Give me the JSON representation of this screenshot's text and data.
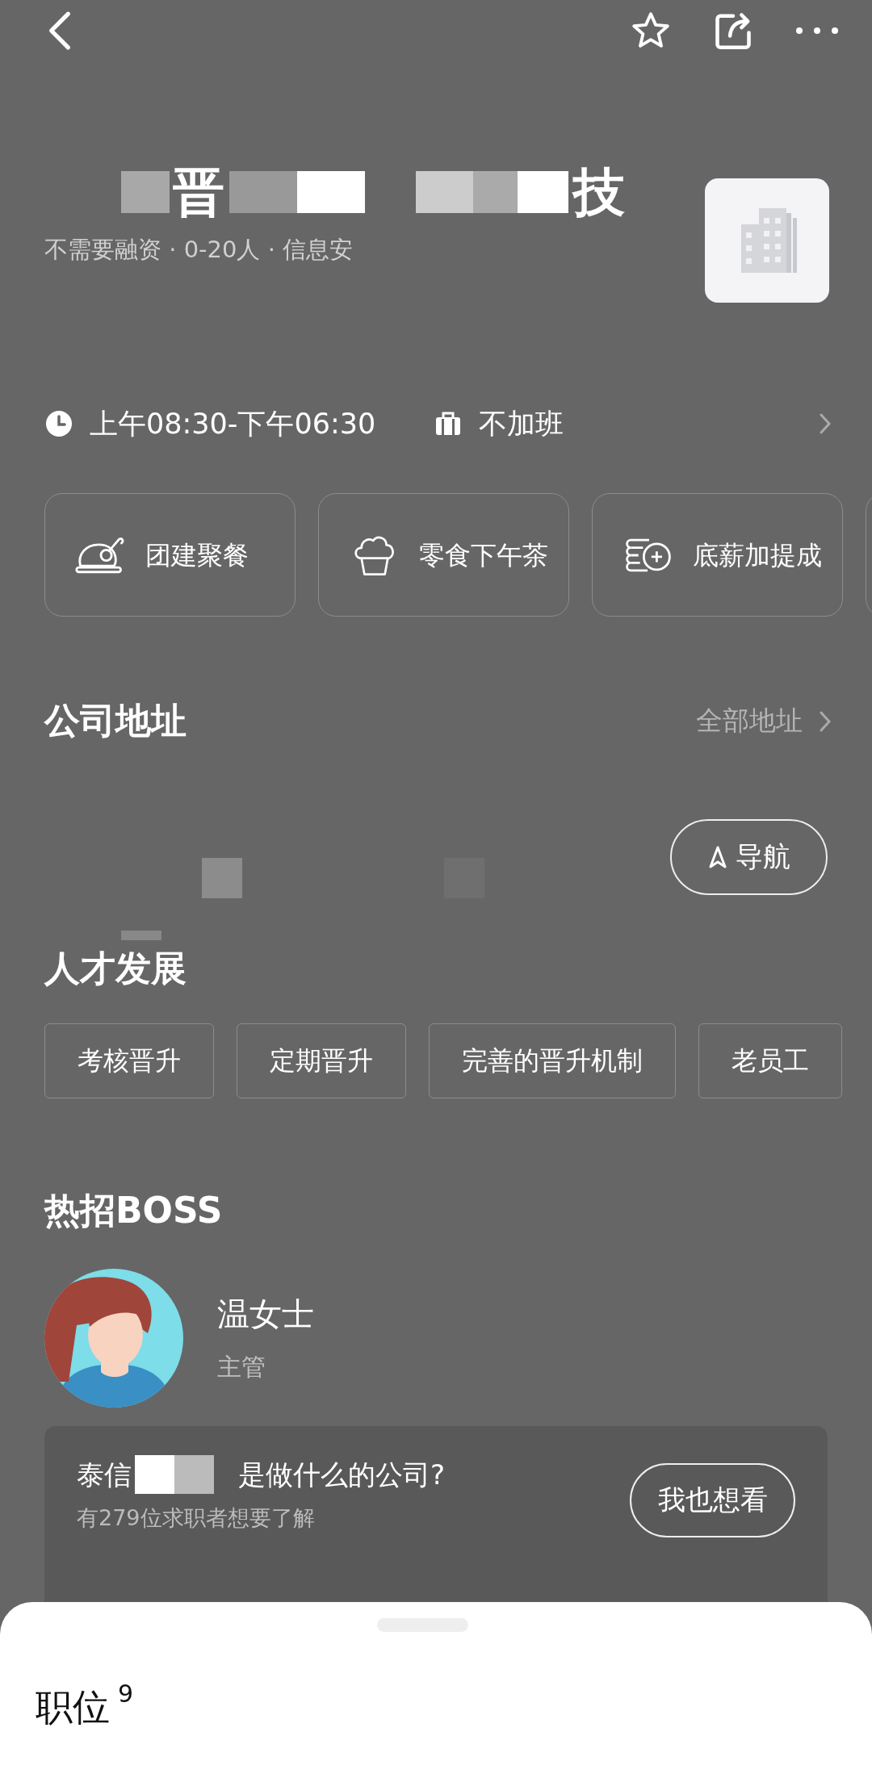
{
  "company": {
    "name_parts": [
      "晋",
      "技"
    ],
    "subtitle": "不需要融资 · 0-20人 · 信息安"
  },
  "hours": {
    "time": "上午08:30-下午06:30",
    "overtime": "不加班"
  },
  "benefits": [
    {
      "kind": "meal",
      "label": "团建聚餐"
    },
    {
      "kind": "snack",
      "label": "零食下午茶"
    },
    {
      "kind": "salary",
      "label": "底薪加提成"
    }
  ],
  "address": {
    "title": "公司地址",
    "all_link": "全部地址",
    "nav_button": "导航"
  },
  "talent": {
    "title": "人才发展",
    "tags": [
      "考核晋升",
      "定期晋升",
      "完善的晋升机制",
      "老员工"
    ]
  },
  "boss": {
    "title": "热招BOSS",
    "name": "温女士",
    "role": "主管"
  },
  "question": {
    "parts": [
      "泰信",
      "是做什么的公司?"
    ],
    "count": "有279位求职者想要了解",
    "button": "我也想看"
  },
  "sheet": {
    "title": "职位",
    "count": "9"
  }
}
